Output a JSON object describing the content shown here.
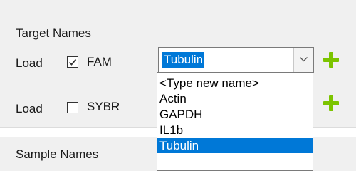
{
  "target_names": {
    "title": "Target Names",
    "rows": [
      {
        "load_label": "Load",
        "checked": true,
        "dye": "FAM"
      },
      {
        "load_label": "Load",
        "checked": false,
        "dye": "SYBR"
      }
    ],
    "combo": {
      "value": "Tubulin",
      "options": [
        "<Type new name>",
        "Actin",
        "GAPDH",
        "IL1b",
        "Tubulin"
      ],
      "selected_index": 4
    }
  },
  "sample_names": {
    "title": "Sample Names"
  },
  "colors": {
    "highlight": "#0078d7",
    "add_icon": "#7cc400",
    "panel_bg": "#f0f0f0"
  },
  "icons": {
    "add": "plus-icon",
    "checkbox_check": "checkmark-icon",
    "combo_arrow": "chevron-down-icon"
  }
}
